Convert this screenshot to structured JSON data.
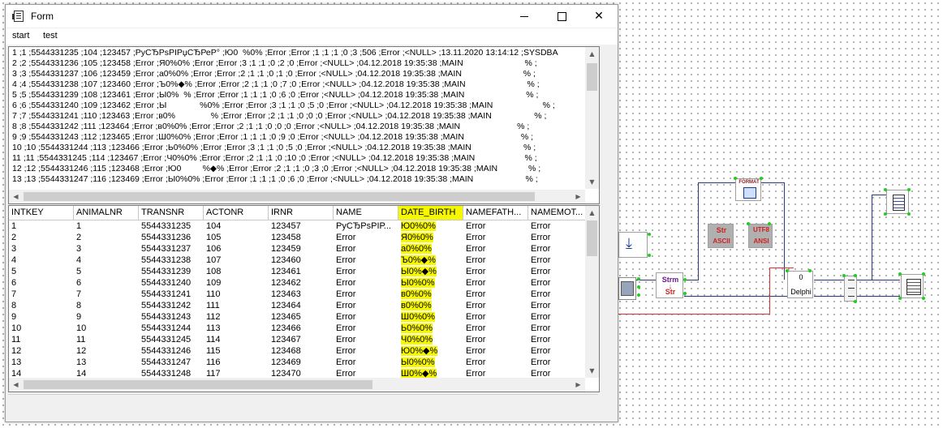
{
  "window": {
    "title": "Form",
    "menu": [
      "start",
      "test"
    ],
    "controls": {
      "minimize": "minimize",
      "maximize": "maximize",
      "close": "✕"
    }
  },
  "memo": {
    "lines": [
      "1 ;1 ;5544331235 ;104 ;123457 ;РуСЂРѕРІРџСЂРеР° ;Ю0  %0% ;Error ;Error ;1 ;1 ;1 ;0 ;3 ;506 ;Error ;<NULL> ;13.11.2020 13:14:12 ;SYSDBA",
      "2 ;2 ;5544331236 ;105 ;123458 ;Error ;Я0%0% ;Error ;Error ;3 ;1 ;1 ;0 ;2 ;0 ;Error ;<NULL> ;04.12.2018 19:35:38 ;MAIN                          % ;",
      "3 ;3 ;5544331237 ;106 ;123459 ;Error ;а0%0% ;Error ;Error ;2 ;1 ;1 ;0 ;1 ;0 ;Error ;<NULL> ;04.12.2018 19:35:38 ;MAIN                          % ;",
      "4 ;4 ;5544331238 ;107 ;123460 ;Error ;Ъ0%◆% ;Error ;Error ;2 ;1 ;1 ;0 ;7 ;0 ;Error ;<NULL> ;04.12.2018 19:35:38 ;MAIN                          % ;",
      "5 ;5 ;5544331239 ;108 ;123461 ;Error ;Ы0%  % ;Error ;Error ;1 ;1 ;1 ;0 ;6 ;0 ;Error ;<NULL> ;04.12.2018 19:35:38 ;MAIN                          % ;",
      "6 ;6 ;5544331240 ;109 ;123462 ;Error ;Ы              %0% ;Error ;Error ;3 ;1 ;1 ;0 ;5 ;0 ;Error ;<NULL> ;04.12.2018 19:35:38 ;MAIN                     % ;",
      "7 ;7 ;5544331241 ;110 ;123463 ;Error ;в0%               % ;Error ;Error ;2 ;1 ;1 ;0 ;0 ;0 ;Error ;<NULL> ;04.12.2018 19:35:38 ;MAIN                  % ;",
      "8 ;8 ;5544331242 ;111 ;123464 ;Error ;в0%0% ;Error ;Error ;2 ;1 ;1 ;0 ;0 ;0 ;Error ;<NULL> ;04.12.2018 19:35:38 ;MAIN                        % ;",
      "9 ;9 ;5544331243 ;112 ;123465 ;Error ;Ш0%0% ;Error ;Error ;1 ;1 ;1 ;0 ;9 ;0 ;Error ;<NULL> ;04.12.2018 19:35:38 ;MAIN                        % ;",
      "10 ;10 ;5544331244 ;113 ;123466 ;Error ;Ь0%0% ;Error ;Error ;3 ;1 ;1 ;0 ;5 ;0 ;Error ;<NULL> ;04.12.2018 19:35:38 ;MAIN                      % ;",
      "11 ;11 ;5544331245 ;114 ;123467 ;Error ;Ч0%0% ;Error ;Error ;2 ;1 ;1 ;0 ;10 ;0 ;Error ;<NULL> ;04.12.2018 19:35:38 ;MAIN                     % ;",
      "12 ;12 ;5544331246 ;115 ;123468 ;Error ;Ю0         %◆% ;Error ;Error ;2 ;1 ;1 ;0 ;3 ;0 ;Error ;<NULL> ;04.12.2018 19:35:38 ;MAIN             % ;",
      "13 ;13 ;5544331247 ;116 ;123469 ;Error ;Ы0%0% ;Error ;Error ;1 ;1 ;1 ;0 ;6 ;0 ;Error ;<NULL> ;04.12.2018 19:35:38 ;MAIN                      % ;"
    ]
  },
  "grid": {
    "columns": [
      "INTKEY",
      "ANIMALNR",
      "TRANSNR",
      "ACTONR",
      "IRNR",
      "NAME",
      "DATE_BIRTH",
      "NAMEFATH...",
      "NAMEMOT..."
    ],
    "rows": [
      [
        "1",
        "1",
        "5544331235",
        "104",
        "123457",
        "РуСЂРѕРІР...",
        "Ю0%0%",
        "Error",
        "Error"
      ],
      [
        "2",
        "2",
        "5544331236",
        "105",
        "123458",
        "Error",
        "Я0%0%",
        "Error",
        "Error"
      ],
      [
        "3",
        "3",
        "5544331237",
        "106",
        "123459",
        "Error",
        "а0%0%",
        "Error",
        "Error"
      ],
      [
        "4",
        "4",
        "5544331238",
        "107",
        "123460",
        "Error",
        "Ъ0%◆%",
        "Error",
        "Error"
      ],
      [
        "5",
        "5",
        "5544331239",
        "108",
        "123461",
        "Error",
        "Ы0%◆%",
        "Error",
        "Error"
      ],
      [
        "6",
        "6",
        "5544331240",
        "109",
        "123462",
        "Error",
        "Ы0%0%",
        "Error",
        "Error"
      ],
      [
        "7",
        "7",
        "5544331241",
        "110",
        "123463",
        "Error",
        "в0%0%",
        "Error",
        "Error"
      ],
      [
        "8",
        "8",
        "5544331242",
        "111",
        "123464",
        "Error",
        "в0%0%",
        "Error",
        "Error"
      ],
      [
        "9",
        "9",
        "5544331243",
        "112",
        "123465",
        "Error",
        "Ш0%0%",
        "Error",
        "Error"
      ],
      [
        "10",
        "10",
        "5544331244",
        "113",
        "123466",
        "Error",
        "Ь0%0%",
        "Error",
        "Error"
      ],
      [
        "11",
        "11",
        "5544331245",
        "114",
        "123467",
        "Error",
        "Ч0%0%",
        "Error",
        "Error"
      ],
      [
        "12",
        "12",
        "5544331246",
        "115",
        "123468",
        "Error",
        "Ю0%◆%",
        "Error",
        "Error"
      ],
      [
        "13",
        "13",
        "5544331247",
        "116",
        "123469",
        "Error",
        "Ы0%0%",
        "Error",
        "Error"
      ],
      [
        "14",
        "14",
        "5544331248",
        "117",
        "123470",
        "Error",
        "Ш0%◆%",
        "Error",
        "Error"
      ]
    ]
  },
  "diagram": {
    "format_label": "FORMAT",
    "str_ascii": {
      "top": "Str",
      "bottom": "ASCII"
    },
    "utf8_ansi": {
      "top": "UTF8",
      "bottom": "ANSI"
    },
    "strm_str": {
      "top": "Strm",
      "bottom": "Str"
    },
    "delphi": {
      "top": "0",
      "bottom": "Delphi"
    },
    "colors": {
      "highlight": "#f7f700",
      "wire_red": "#e03030",
      "wire_blue": "#2a3a7a",
      "pin": "#22cc22"
    }
  }
}
